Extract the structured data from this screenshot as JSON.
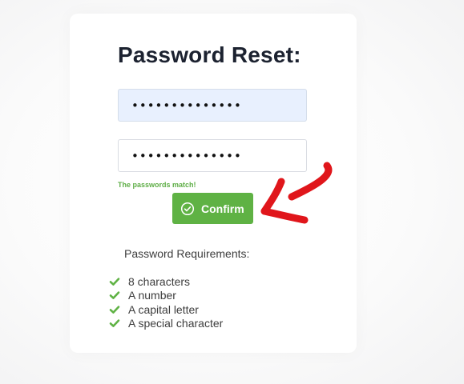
{
  "form": {
    "title": "Password Reset:",
    "password_value": "••••••••••••••",
    "confirm_password_value": "••••••••••••••",
    "match_message": "The passwords match!",
    "confirm_label": "Confirm"
  },
  "requirements": {
    "heading": "Password Requirements:",
    "items": [
      {
        "label": "8 characters",
        "met": true
      },
      {
        "label": "A number",
        "met": true
      },
      {
        "label": "A capital letter",
        "met": true
      },
      {
        "label": "A special character",
        "met": true
      }
    ]
  },
  "colors": {
    "accent_green": "#5fb244",
    "match_text_green": "#5fae47",
    "annotation_red": "#e0161b",
    "autofill_blue": "#e8f0fe"
  },
  "icons": {
    "confirm_icon": "check-circle-icon",
    "requirement_icon": "checkmark-icon",
    "annotation": "red-arrow-annotation"
  }
}
